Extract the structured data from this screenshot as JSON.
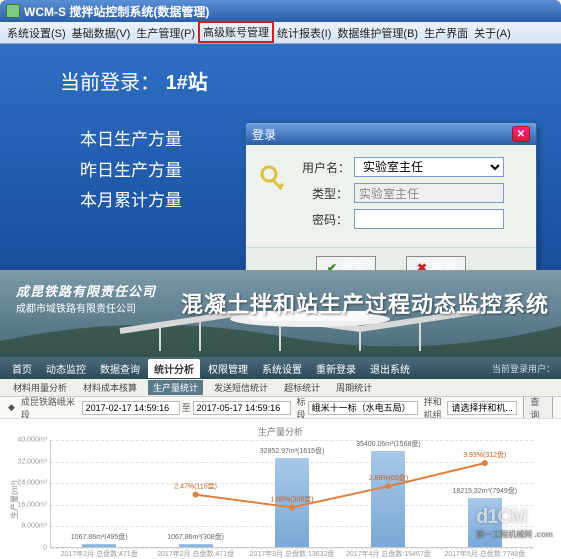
{
  "app": {
    "title": "WCM-S 搅拌站控制系统(数据管理)",
    "menu": [
      "系统设置(S)",
      "基础数据(V)",
      "生产管理(P)",
      "高级账号管理",
      "统计报表(I)",
      "数据维护管理(B)",
      "生产界面",
      "关于(A)"
    ],
    "highlighted_menu_index": 3,
    "current_login_label": "当前登录：",
    "current_login_value": "1#站",
    "stats": [
      "本日生产方量",
      "昨日生产方量",
      "本月累计方量"
    ]
  },
  "dialog": {
    "title": "登录",
    "close_symbol": "✕",
    "fields": {
      "username_label": "用户名：",
      "username_value": "实验室主任",
      "type_label": "类型：",
      "type_value": "实验室主任",
      "password_label": "密码："
    },
    "ok_label": "确定",
    "cancel_label": "取消"
  },
  "web": {
    "org_line1": "成昆铁路有限责任公司",
    "org_line2": "成都市域铁路有限责任公司",
    "system_title": "混凝土拌和站生产过程动态监控系统",
    "nav": [
      "首页",
      "动态监控",
      "数据查询",
      "统计分析",
      "权限管理",
      "系统设置",
      "重新登录",
      "退出系统"
    ],
    "active_nav_index": 3,
    "login_user_label": "当前登录用户：",
    "subnav": [
      "材料用量分析",
      "材料成本核算",
      "生产量统计",
      "发送短信统计",
      "超标统计",
      "周期统计"
    ],
    "active_sub_index": 2,
    "filter_section_label": "成昆铁路峨米段",
    "date_from": "2017-02-17 14:59:16",
    "date_to": "2017-05-17 14:59:16",
    "project_label": "标段",
    "project_value": "峨米十一标（水电五局）",
    "mixer_label": "拌和机组",
    "mixer_value": "请选择拌和机...",
    "query_label": "查询",
    "chart_title": "生产量分析"
  },
  "chart_data": {
    "type": "bar+line",
    "ylabel": "生产量(m³)",
    "ylim": [
      0,
      40000
    ],
    "y_ticks": [
      0,
      8000,
      16000,
      24000,
      32000,
      40000
    ],
    "y_tick_labels": [
      "0",
      "8,000m³",
      "16,000m³",
      "24,000m³",
      "32,000m³",
      "40,000m³"
    ],
    "categories": [
      "2017年2月\n总盘数:471盘",
      "2017年2月\n总盘数:471盘",
      "2017年3月\n总盘数:13632盘",
      "2017年4月\n总盘数:15467盘",
      "2017年5月\n总盘数:7749盘"
    ],
    "bars": [
      {
        "value": 1067.86,
        "label": "1067.86m³(495盘)"
      },
      {
        "value": 1067.86,
        "label": "1067.86m³(308盘)"
      },
      {
        "value": 32852.97,
        "label": "32852.97m³(1615盘)"
      },
      {
        "value": 35400.06,
        "label": "35400.06m³(1568盘)"
      },
      {
        "value": 18215.32,
        "label": "18215.32m³(7949盘)"
      }
    ],
    "line_points": [
      {
        "x_index": 1,
        "pct": 2.47,
        "label": "2.47%(115盘)"
      },
      {
        "x_index": 2,
        "pct": 1.88,
        "label": "1.88%(308盘)"
      },
      {
        "x_index": 3,
        "pct": 2.86,
        "label": "2.86%(65盘)"
      },
      {
        "x_index": 4,
        "pct": 3.93,
        "label": "3.93%(312盘)"
      }
    ]
  },
  "watermark": {
    "main": "d1CM",
    "sub": "第一工程机械网 .com"
  }
}
